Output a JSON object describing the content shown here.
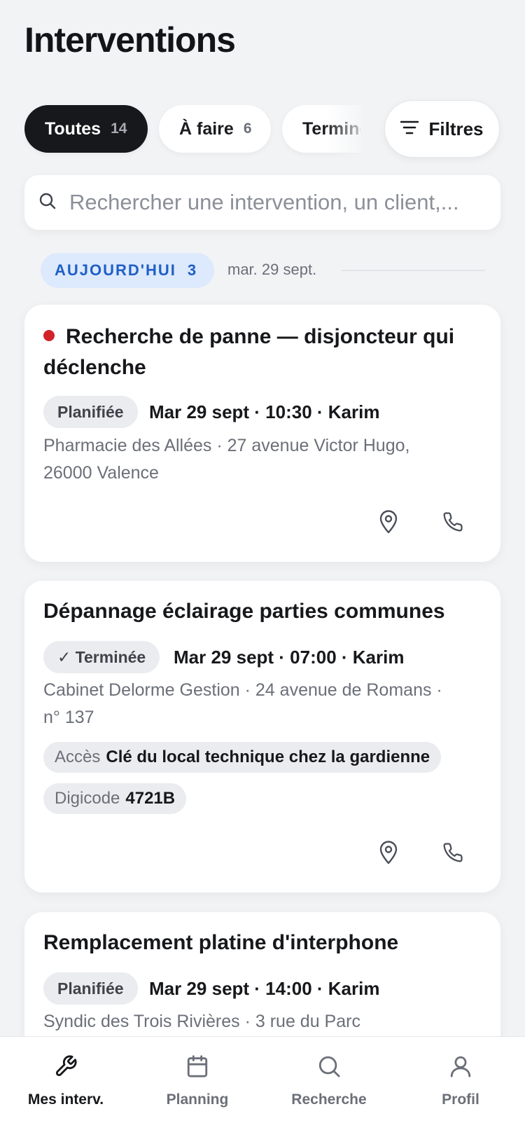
{
  "header": {
    "title": "Interventions"
  },
  "filters": {
    "chips": [
      {
        "label": "Toutes",
        "count": "14"
      },
      {
        "label": "À faire",
        "count": "6"
      },
      {
        "label": "Terminées",
        "count": ""
      }
    ],
    "filters_button": "Filtres"
  },
  "search": {
    "placeholder": "Rechercher une intervention, un client,..."
  },
  "section": {
    "label": "AUJOURD'HUI",
    "count": "3",
    "date": "mar. 29 sept."
  },
  "interventions": [
    {
      "title": "Recherche de panne — disjoncteur qui déclenche",
      "urgent": true,
      "status": "Planifiée",
      "meta": "Mar 29 sept · 10:30 · Karim",
      "address": "Pharmacie des Allées · 27 avenue Victor Hugo, 26000 Valence"
    },
    {
      "title": "Dépannage éclairage parties communes",
      "urgent": false,
      "status": "✓ Terminée",
      "meta": "Mar 29 sept · 07:00 · Karim",
      "address": "Cabinet Delorme Gestion · 24 avenue de Romans · n° 137",
      "access_label": "Accès",
      "access_value": "Clé du local technique chez la gardienne",
      "digicode_label": "Digicode",
      "digicode_value": "4721B"
    },
    {
      "title": "Remplacement platine d'interphone",
      "urgent": false,
      "status": "Planifiée",
      "meta": "Mar 29 sept · 14:00 · Karim",
      "address": "Syndic des Trois Rivières · 3 rue du Parc"
    }
  ],
  "nav": {
    "items": [
      {
        "label": "Mes interv.",
        "icon": "wrench-icon",
        "active": true
      },
      {
        "label": "Planning",
        "icon": "calendar-icon",
        "active": false
      },
      {
        "label": "Recherche",
        "icon": "search-icon",
        "active": false
      },
      {
        "label": "Profil",
        "icon": "user-icon",
        "active": false
      }
    ]
  },
  "colors": {
    "accent_blue": "#1f5fc6",
    "urgent_red": "#d2232a",
    "active_chip": "#17181b",
    "background": "#f2f3f5"
  }
}
